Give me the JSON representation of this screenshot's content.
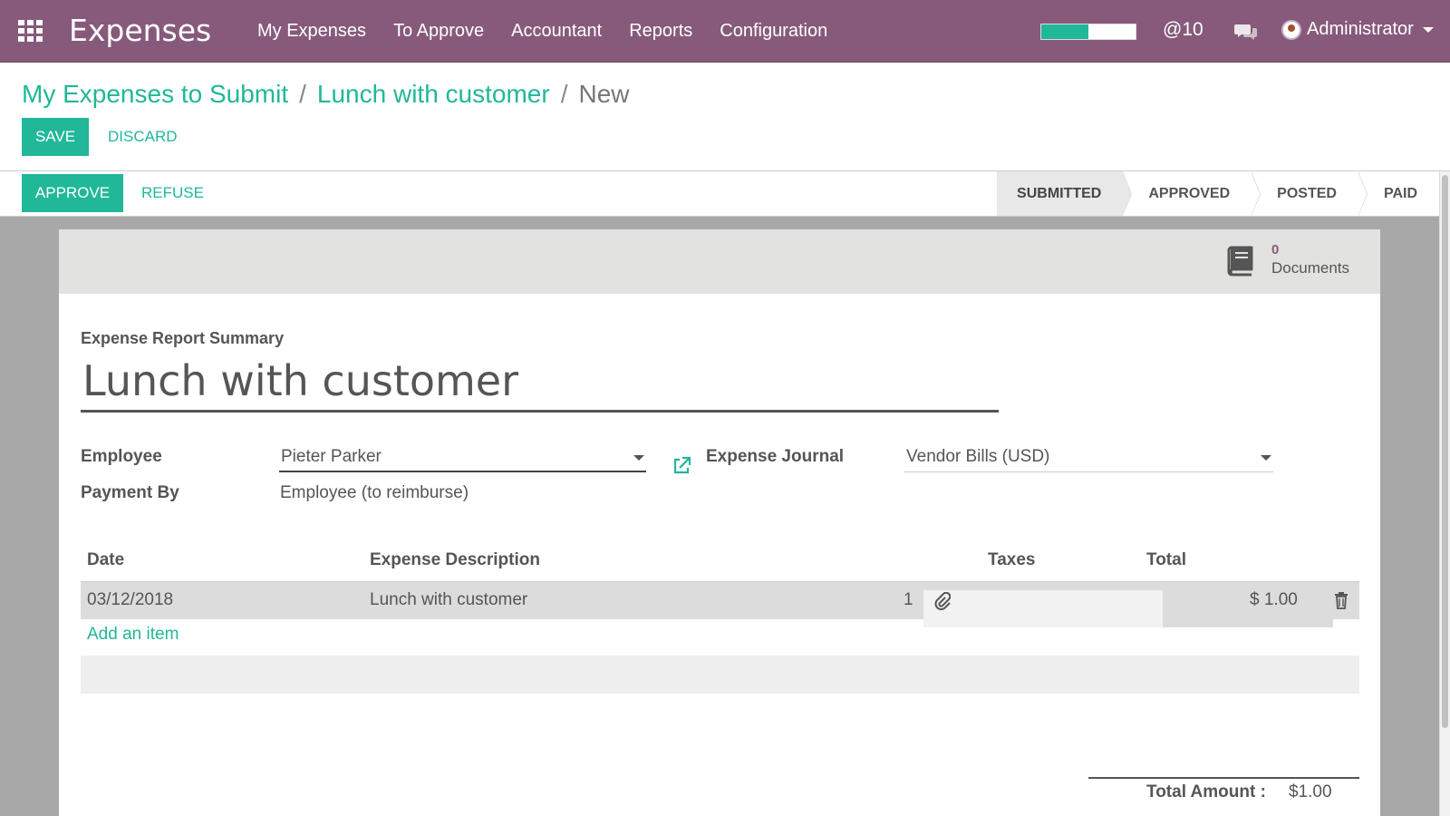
{
  "navbar": {
    "app_title": "Expenses",
    "menu": [
      "My Expenses",
      "To Approve",
      "Accountant",
      "Reports",
      "Configuration"
    ],
    "progress_fraction": 0.5,
    "mentions_label": "@10",
    "user_name": "Administrator"
  },
  "breadcrumb": {
    "items": [
      "My Expenses to Submit",
      "Lunch with customer"
    ],
    "separator": "/",
    "current": "New"
  },
  "buttons": {
    "save": "SAVE",
    "discard": "DISCARD",
    "approve": "APPROVE",
    "refuse": "REFUSE"
  },
  "stages": {
    "items": [
      "SUBMITTED",
      "APPROVED",
      "POSTED",
      "PAID"
    ],
    "active": "SUBMITTED"
  },
  "smart_button": {
    "count": "0",
    "label": "Documents"
  },
  "form": {
    "summary_label": "Expense Report Summary",
    "title": "Lunch with customer",
    "employee_label": "Employee",
    "employee_value": "Pieter Parker",
    "payment_by_label": "Payment By",
    "payment_by_value": "Employee (to reimburse)",
    "journal_label": "Expense Journal",
    "journal_value": "Vendor Bills (USD)"
  },
  "table": {
    "headers": {
      "date": "Date",
      "description": "Expense Description",
      "taxes": "Taxes",
      "total": "Total"
    },
    "rows": [
      {
        "date": "03/12/2018",
        "description": "Lunch with customer",
        "attachment_count": "1",
        "total": "$ 1.00"
      }
    ],
    "add_item": "Add an item"
  },
  "totals": {
    "label": "Total Amount :",
    "value": "$1.00"
  },
  "colors": {
    "navbar": "#875a7b",
    "accent": "#21b799"
  }
}
